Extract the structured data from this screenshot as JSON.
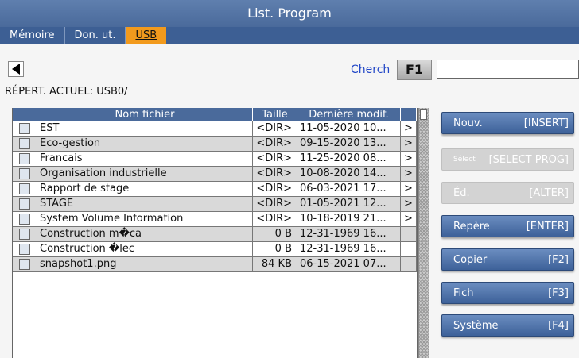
{
  "window": {
    "title": "List. Program"
  },
  "tabs": [
    {
      "label": "Mémoire",
      "active": false
    },
    {
      "label": "Don. ut.",
      "active": false
    },
    {
      "label": "USB",
      "active": true
    }
  ],
  "toolbar": {
    "back_icon": "left-triangle-icon",
    "search_label": "Cherch",
    "search_key": "F1",
    "search_value": ""
  },
  "current_dir": "RÉPERT. ACTUEL: USB0/",
  "table": {
    "columns": [
      "",
      "Nom fichier",
      "Taille",
      "Dernière modif.",
      ""
    ],
    "rows": [
      {
        "name": "EST",
        "size": "<DIR>",
        "date": "11-05-2020 10...",
        "arrow": ">"
      },
      {
        "name": "Eco-gestion",
        "size": "<DIR>",
        "date": "09-15-2020 13...",
        "arrow": ">"
      },
      {
        "name": "Francais",
        "size": "<DIR>",
        "date": "11-25-2020 08...",
        "arrow": ">"
      },
      {
        "name": "Organisation industrielle",
        "size": "<DIR>",
        "date": "10-08-2020 14...",
        "arrow": ">"
      },
      {
        "name": "Rapport de stage",
        "size": "<DIR>",
        "date": "06-03-2021 17...",
        "arrow": ">"
      },
      {
        "name": "STAGE",
        "size": "<DIR>",
        "date": "01-05-2021 12...",
        "arrow": ">"
      },
      {
        "name": "System Volume Information",
        "size": "<DIR>",
        "date": "10-18-2019 21...",
        "arrow": ">"
      },
      {
        "name": "Construction m�ca",
        "size": "0 B",
        "date": "12-31-1969 16...",
        "arrow": ""
      },
      {
        "name": "Construction �lec",
        "size": "0 B",
        "date": "12-31-1969 16...",
        "arrow": ""
      },
      {
        "name": "snapshot1.png",
        "size": "84 KB",
        "date": "06-15-2021 07...",
        "arrow": ""
      }
    ]
  },
  "side_buttons": [
    {
      "label": "Nouv.",
      "key": "[INSERT]",
      "enabled": true
    },
    {
      "label": "Sélect",
      "key": "[SELECT PROG]",
      "enabled": false
    },
    {
      "label": "Éd.",
      "key": "[ALTER]",
      "enabled": false
    },
    {
      "label": "Repère",
      "key": "[ENTER]",
      "enabled": true
    },
    {
      "label": "Copier",
      "key": "[F2]",
      "enabled": true
    },
    {
      "label": "Fich",
      "key": "[F3]",
      "enabled": true
    },
    {
      "label": "Système",
      "key": "[F4]",
      "enabled": true
    }
  ]
}
